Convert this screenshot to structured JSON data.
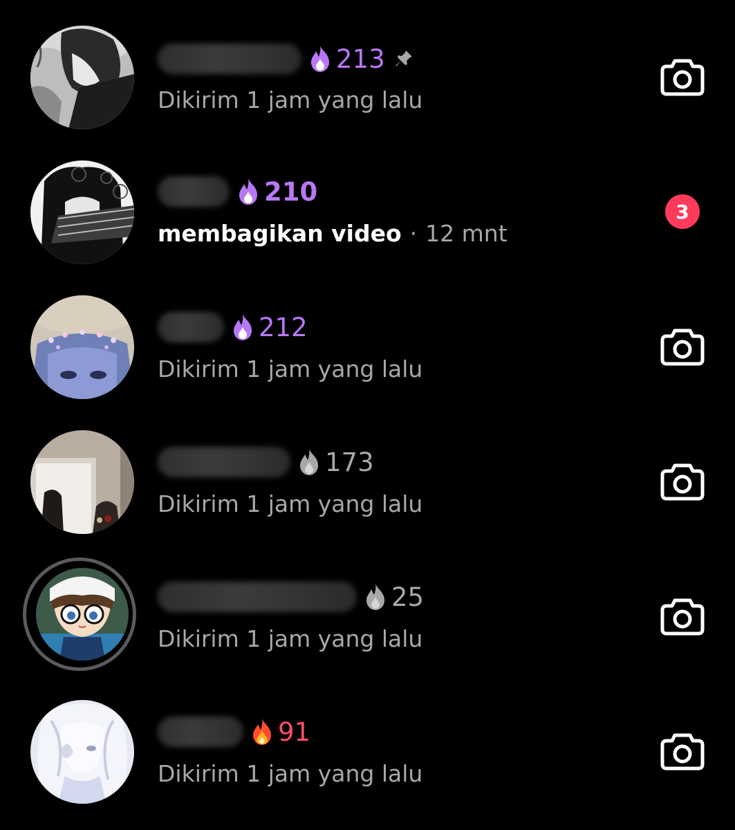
{
  "colors": {
    "background": "#000000",
    "streak_purple": "#b878f5",
    "streak_gray": "#a8a8a8",
    "streak_red": "#ff4d6a",
    "badge_red": "#ff3b5c",
    "secondary_text": "#a8a8a8"
  },
  "conversations": [
    {
      "streak_count": "213",
      "streak_icon": "purple-flame-icon",
      "pinned": true,
      "status": "Dikirim 1 jam yang lalu",
      "action_icon": "camera-icon"
    },
    {
      "streak_count": "210",
      "streak_icon": "purple-flame-icon",
      "activity": "membagikan video",
      "separator": "·",
      "time": "12 mnt",
      "unread_count": "3"
    },
    {
      "streak_count": "212",
      "streak_icon": "purple-flame-icon",
      "status": "Dikirim 1 jam yang lalu",
      "action_icon": "camera-icon"
    },
    {
      "streak_count": "173",
      "streak_icon": "gray-flame-icon",
      "status": "Dikirim 1 jam yang lalu",
      "action_icon": "camera-icon"
    },
    {
      "streak_count": "25",
      "streak_icon": "gray-flame-icon",
      "has_story": true,
      "status": "Dikirim 1 jam yang lalu",
      "action_icon": "camera-icon"
    },
    {
      "streak_count": "91",
      "streak_icon": "red-flame-icon",
      "status": "Dikirim 1 jam yang lalu",
      "action_icon": "camera-icon"
    }
  ]
}
